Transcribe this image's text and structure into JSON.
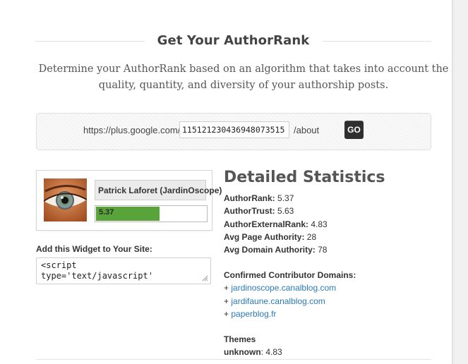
{
  "header": {
    "title": "Get Your AuthorRank",
    "subtitle_line1": "Determine your AuthorRank based on an algorithm that takes into account the",
    "subtitle_line2": "quality, quantity, and diversity of your authorship posts."
  },
  "url_form": {
    "prefix": "https://plus.google.com/",
    "profile_id": "115121230436948073515",
    "suffix": "/about",
    "go_label": "GO"
  },
  "profile": {
    "name": "Patrick Laforet (JardinOscope)",
    "rank_value": "5.37",
    "rank_fill_fraction": 0.58,
    "avatar_icon": "eye-photo"
  },
  "widget": {
    "label": "Add this Widget to Your Site:",
    "code": "<script\ntype='text/javascript'"
  },
  "stats": {
    "title": "Detailed Statistics",
    "author_rank_label": "AuthorRank:",
    "author_rank_value": "5.37",
    "author_trust_label": "AuthorTrust:",
    "author_trust_value": "5.63",
    "author_external_rank_label": "AuthorExternalRank:",
    "author_external_rank_value": "4.83",
    "avg_page_authority_label": "Avg Page Authority:",
    "avg_page_authority_value": "28",
    "avg_domain_authority_label": "Avg Domain Authority:",
    "avg_domain_authority_value": "78",
    "domains_heading": "Confirmed Contributor Domains:",
    "domain_bullet": "+",
    "domains": [
      "jardinoscope.canalblog.com",
      "jardifaune.canalblog.com",
      "paperblog.fr"
    ],
    "themes_heading": "Themes",
    "theme_label": "unknown",
    "theme_value": "4.83"
  },
  "colors": {
    "rank_bar_fill": "#59a33b",
    "link": "#2a7ab8",
    "go_button": "#2f2f2f"
  }
}
